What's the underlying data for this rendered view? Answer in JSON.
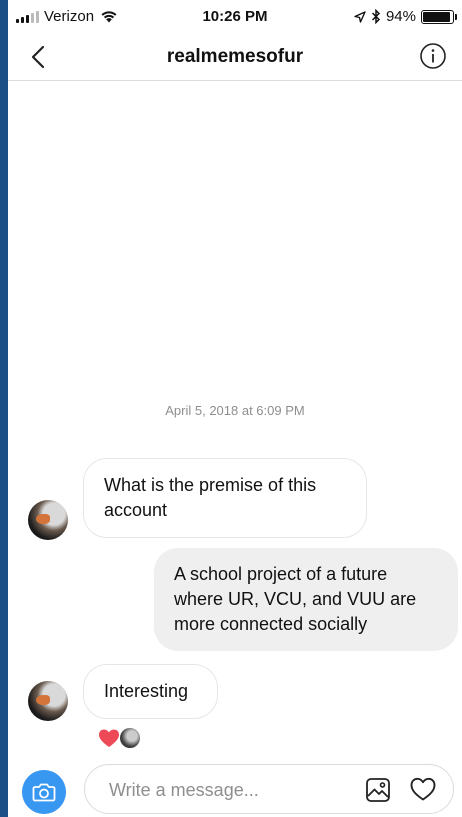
{
  "status_bar": {
    "carrier": "Verizon",
    "time": "10:26 PM",
    "battery_text": "94%",
    "battery_level": 0.94
  },
  "header": {
    "title": "realmemesofur",
    "back_icon": "chevron-left-icon",
    "info_icon": "info-icon"
  },
  "conversation": {
    "timestamp": "April 5, 2018 at 6:09 PM",
    "messages": [
      {
        "direction": "incoming",
        "text": "What is the premise of this account"
      },
      {
        "direction": "outgoing",
        "text": "A school project of a future where UR, VCU, and VUU are more connected socially"
      },
      {
        "direction": "incoming",
        "text": "Interesting"
      }
    ],
    "reactions": [
      "heart-icon",
      "avatar"
    ]
  },
  "composer": {
    "placeholder": "Write a message...",
    "value": "",
    "camera_icon": "camera-icon",
    "gallery_icon": "image-icon",
    "like_icon": "heart-outline-icon"
  },
  "colors": {
    "accent": "#3897f0",
    "reaction_heart": "#ed4956",
    "outgoing_bubble": "#efefef",
    "background_frame": "#1b4f86"
  }
}
